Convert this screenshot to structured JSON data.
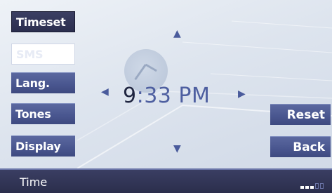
{
  "menu": {
    "items": [
      {
        "label": "Timeset",
        "state": "selected"
      },
      {
        "label": "SMS",
        "state": "disabled"
      },
      {
        "label": "Lang.",
        "state": "normal"
      },
      {
        "label": "Tones",
        "state": "normal"
      },
      {
        "label": "Display",
        "state": "normal"
      }
    ]
  },
  "clock": {
    "hour": "9",
    "rest": ":33 PM"
  },
  "actions": {
    "reset_label": "Reset",
    "back_label": "Back"
  },
  "status_bar": {
    "label": "Time",
    "signal_level": 3,
    "signal_max": 5
  },
  "colors": {
    "button": "#4a5790",
    "selected": "#2b2e4e",
    "accent_text": "#4e5fa0",
    "status_bar": "#2a2d4a"
  },
  "icons": {
    "up": "arrow-up-icon",
    "down": "arrow-down-icon",
    "left": "arrow-left-icon",
    "right": "arrow-right-icon",
    "signal": "signal-strength-icon",
    "clock": "clock-face-icon"
  }
}
